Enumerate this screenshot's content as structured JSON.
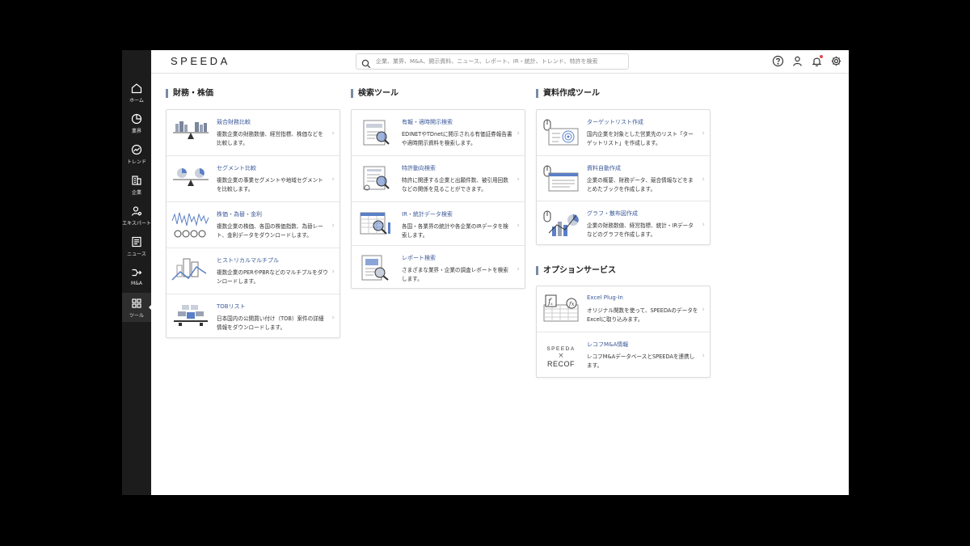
{
  "app": {
    "logo": "SPEEDA"
  },
  "search": {
    "placeholder": "企業、業界、M&A、開示資料、ニュース、レポート、IR・統計、トレンド、特許を検索"
  },
  "sidebar": {
    "items": [
      {
        "label": "ホーム",
        "icon": "home-icon"
      },
      {
        "label": "業界",
        "icon": "pie-chart-icon"
      },
      {
        "label": "トレンド",
        "icon": "trend-icon"
      },
      {
        "label": "企業",
        "icon": "building-icon"
      },
      {
        "label": "エキスパート",
        "icon": "expert-icon"
      },
      {
        "label": "ニュース",
        "icon": "news-icon"
      },
      {
        "label": "M&A",
        "icon": "merge-icon"
      },
      {
        "label": "ツール",
        "icon": "grid-icon",
        "active": true
      }
    ]
  },
  "header": {
    "icons": [
      "help-icon",
      "user-icon",
      "bell-icon",
      "gear-icon"
    ]
  },
  "sections": {
    "finance": {
      "title": "財務・株価",
      "items": [
        {
          "title": "競合財務比較",
          "desc": "複数企業の財務数値、経営指標、株価などを比較します。"
        },
        {
          "title": "セグメント比較",
          "desc": "複数企業の事業セグメントや地域セグメントを比較します。"
        },
        {
          "title": "株価・為替・金利",
          "desc": "複数企業の株価、各国の株価指数、為替レート、金利データをダウンロードします。"
        },
        {
          "title": "ヒストリカルマルチプル",
          "desc": "複数企業のPERやPBRなどのマルチプルをダウンロードします。"
        },
        {
          "title": "TOBリスト",
          "desc": "日本国内の公開買い付け（TOB）案件の詳細情報をダウンロードします。"
        }
      ]
    },
    "search_tools": {
      "title": "検索ツール",
      "items": [
        {
          "title": "有報・適時開示検索",
          "desc": "EDINETやTDnetに開示される有価証券報告書や適時開示資料を検索します。"
        },
        {
          "title": "特許動向検索",
          "desc": "特許に関連する企業と出願件数、被引用回数などの関係を見ることができます。"
        },
        {
          "title": "IR・統計データ検索",
          "desc": "各国・各業界の統計や各企業のIRデータを検索します。"
        },
        {
          "title": "レポート検索",
          "desc": "さまざまな業界・企業の調査レポートを検索します。"
        }
      ]
    },
    "docs": {
      "title": "資料作成ツール",
      "items": [
        {
          "title": "ターゲットリスト作成",
          "desc": "国内企業を対象とした営業先のリスト「ターゲットリスト」を作成します。"
        },
        {
          "title": "資料自動作成",
          "desc": "企業の概要、財務データ、競合情報などをまとめたブックを作成します。"
        },
        {
          "title": "グラフ・散布図作成",
          "desc": "企業の財務数値、経営指標、統計・IRデータなどのグラフを作成します。"
        }
      ]
    },
    "options": {
      "title": "オプションサービス",
      "items": [
        {
          "title": "Excel Plug-In",
          "desc": "オリジナル関数を使って、SPEEDAのデータをExcelに取り込みます。"
        },
        {
          "title": "レコフM&A情報",
          "desc": "レコフM&AデータベースとSPEEDAを連携します。"
        }
      ],
      "recof_logo_top": "SPEEDA",
      "recof_logo_x": "×",
      "recof_logo_bottom": "RECOF"
    }
  },
  "colors": {
    "accent": "#3b5998",
    "sidebar": "#1c1c1c",
    "thumb_blue": "#5b7fc7"
  }
}
